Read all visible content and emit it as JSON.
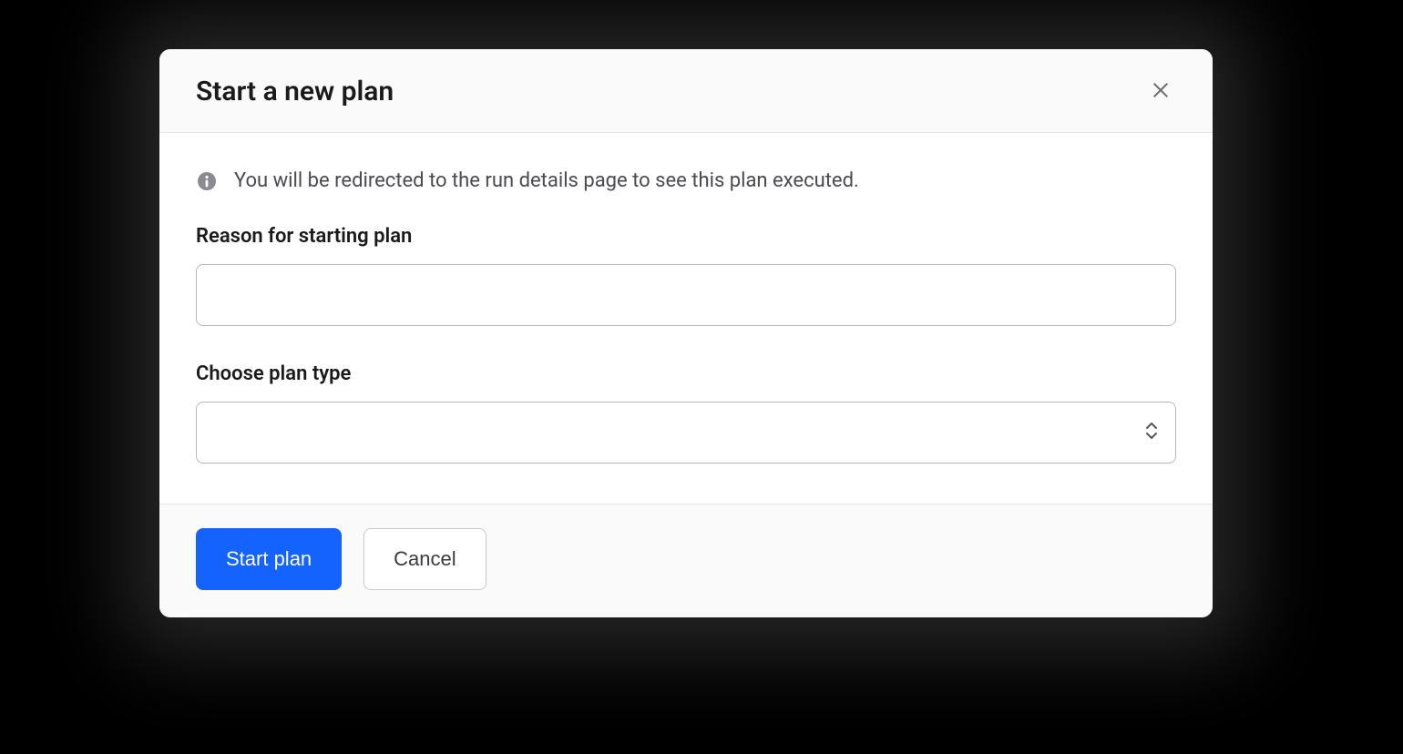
{
  "modal": {
    "title": "Start a new plan",
    "info_text": "You will be redirected to the run details page to see this plan executed.",
    "reason": {
      "label": "Reason for starting plan",
      "value": ""
    },
    "plan_type": {
      "label": "Choose plan type",
      "value": ""
    },
    "actions": {
      "submit_label": "Start plan",
      "cancel_label": "Cancel"
    }
  }
}
